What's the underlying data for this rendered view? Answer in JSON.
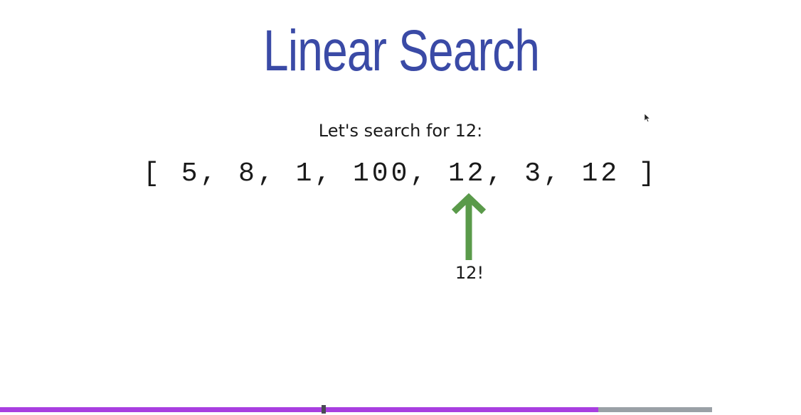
{
  "slide": {
    "title": "Linear Search",
    "subtitle": "Let's search for 12:",
    "array_text": "[ 5, 8, 1, 100, 12, 3, 12 ]",
    "found_label": "12!"
  },
  "player": {
    "progress_fraction": 0.84,
    "progress_color": "#a83ee0",
    "track_color": "#9aa0a6"
  },
  "colors": {
    "title": "#3a4aa6",
    "arrow": "#5a9a4a"
  },
  "icons": {
    "arrow": "up-arrow-icon",
    "cursor": "mouse-pointer-icon"
  }
}
